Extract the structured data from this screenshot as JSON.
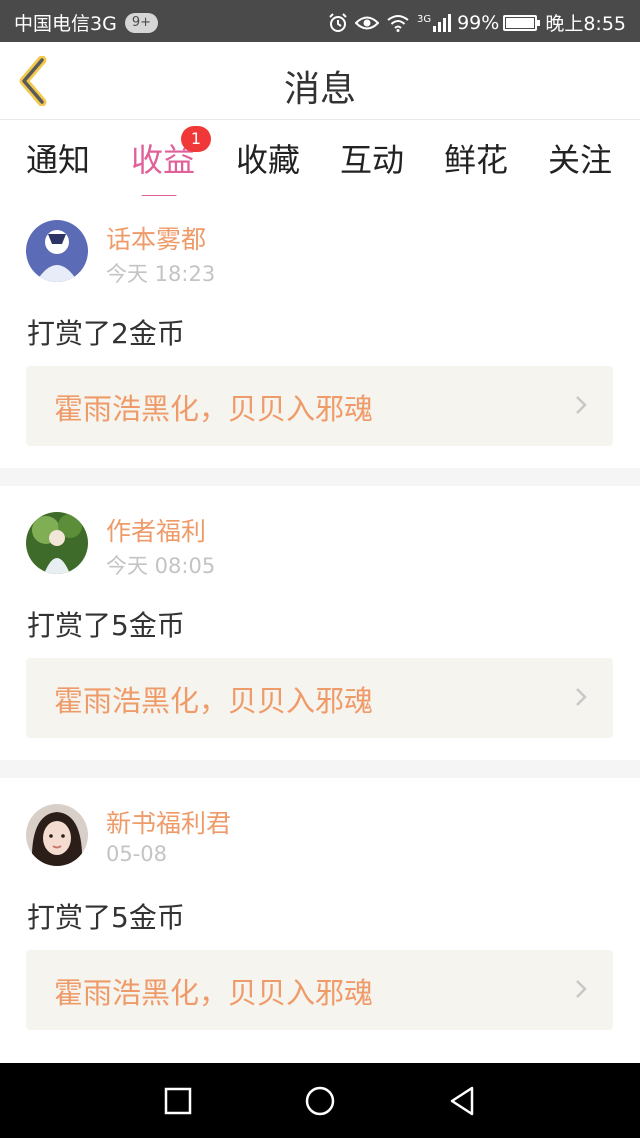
{
  "status_bar": {
    "carrier": "中国电信3G",
    "notif_badge": "9+",
    "network": "3G",
    "battery": "99%",
    "battery_level": 0.99,
    "time": "晚上8:55"
  },
  "navbar": {
    "title": "消息"
  },
  "tabs": [
    {
      "label": "通知"
    },
    {
      "label": "收益",
      "badge": "1",
      "active": true
    },
    {
      "label": "收藏"
    },
    {
      "label": "互动"
    },
    {
      "label": "鲜花"
    },
    {
      "label": "关注"
    }
  ],
  "messages": [
    {
      "sender": "话本雾都",
      "time": "今天 18:23",
      "text": "打赏了2金币",
      "book": "霍雨浩黑化，贝贝入邪魂"
    },
    {
      "sender": "作者福利",
      "time": "今天 08:05",
      "text": "打赏了5金币",
      "book": "霍雨浩黑化，贝贝入邪魂"
    },
    {
      "sender": "新书福利君",
      "time": "05-08",
      "text": "打赏了5金币",
      "book": "霍雨浩黑化，贝贝入邪魂"
    }
  ],
  "colors": {
    "accent_pink": "#e0609a",
    "accent_orange": "#ef9b69",
    "badge_red": "#f03838"
  },
  "icons": {
    "back": "chevron-left-icon",
    "chevron": "chevron-right-icon",
    "recents": "square-icon",
    "home": "circle-icon",
    "back_nav": "triangle-back-icon"
  }
}
